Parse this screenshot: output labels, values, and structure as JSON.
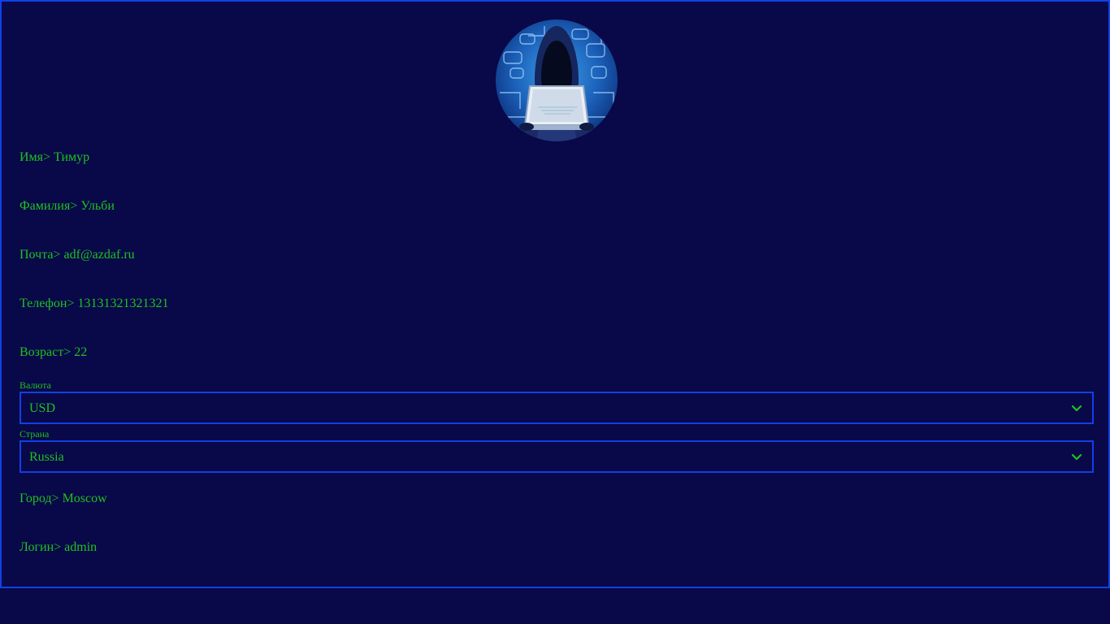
{
  "profile": {
    "fields": [
      {
        "label": "Имя",
        "value": "Тимур"
      },
      {
        "label": "Фамилия",
        "value": "Ульби"
      },
      {
        "label": "Почта",
        "value": "adf@azdaf.ru"
      },
      {
        "label": "Телефон",
        "value": "13131321321321"
      },
      {
        "label": "Возраст",
        "value": "22"
      }
    ],
    "separator": ">",
    "currency": {
      "label": "Валюта",
      "selected": "USD"
    },
    "country": {
      "label": "Страна",
      "selected": "Russia"
    },
    "city": {
      "label": "Город",
      "value": "Moscow"
    },
    "login": {
      "label": "Логин",
      "value": "admin"
    }
  },
  "avatar": {
    "icon": "hacker-avatar-icon"
  },
  "colors": {
    "background": "#090849",
    "border": "#1140e6",
    "text": "#1ec31e"
  }
}
